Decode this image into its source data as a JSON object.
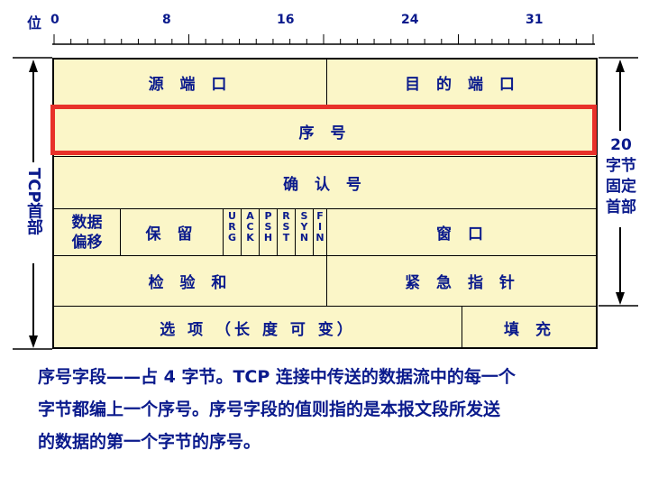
{
  "ruler": {
    "label": "位",
    "ticks": [
      "0",
      "8",
      "16",
      "24",
      "31"
    ]
  },
  "rows": {
    "source_port": "源 端 口",
    "dest_port": "目 的 端 口",
    "seq": "序  号",
    "ack": "确  认  号",
    "data_offset_1": "数据",
    "data_offset_2": "偏移",
    "reserved": "保  留",
    "flags": [
      [
        "U",
        "R",
        "G"
      ],
      [
        "A",
        "C",
        "K"
      ],
      [
        "P",
        "S",
        "H"
      ],
      [
        "R",
        "S",
        "T"
      ],
      [
        "S",
        "Y",
        "N"
      ],
      [
        "F",
        "I",
        "N"
      ]
    ],
    "window": "窗  口",
    "checksum": "检 验 和",
    "urgent": "紧 急 指 针",
    "options": "选  项  （长 度 可 变）",
    "padding": "填  充"
  },
  "side": {
    "left": "TCP首部",
    "right_num": "20",
    "right_1": "字节",
    "right_2": "固定",
    "right_3": "首部"
  },
  "caption": {
    "line1": "序号字段——占 4 字节。TCP 连接中传送的数据流中的每一个",
    "line2": "字节都编上一个序号。序号字段的值则指的是本报文段所发送",
    "line3": "的数据的第一个字节的序号。"
  },
  "colors": {
    "text": "#0a1a8c",
    "fill": "#fbf6c8",
    "highlight": "#e8312a"
  }
}
